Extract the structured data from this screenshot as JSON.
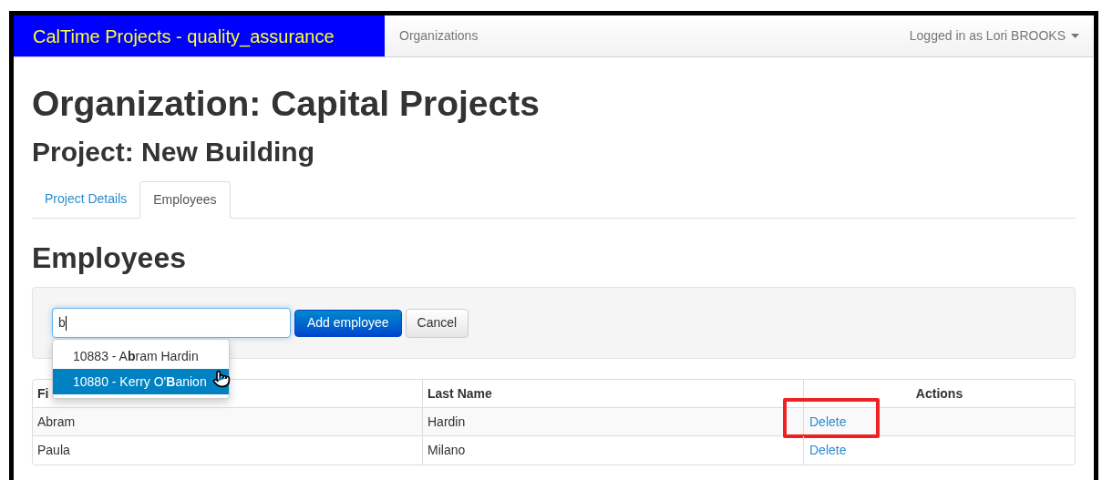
{
  "navbar": {
    "brand": "CalTime Projects - quality_assurance",
    "links": [
      {
        "label": "Organizations"
      }
    ],
    "user_menu": "Logged in as Lori BROOKS"
  },
  "headings": {
    "organization": "Organization: Capital Projects",
    "project": "Project: New Building"
  },
  "tabs": [
    {
      "label": "Project Details",
      "selected": false
    },
    {
      "label": "Employees",
      "selected": true
    }
  ],
  "section_title": "Employees",
  "add_form": {
    "value": "b",
    "buttons": [
      {
        "label": "Add employee",
        "kind": "primary"
      },
      {
        "label": "Cancel",
        "kind": "default"
      }
    ],
    "suggestions": [
      {
        "label": "10883 - A**b**ram Hardin",
        "selected": false
      },
      {
        "label": "10880 - Kerry O'**B**anion",
        "selected": true
      }
    ]
  },
  "table": {
    "columns": [
      "Fi",
      "Last Name",
      "Actions"
    ],
    "rows": [
      {
        "first_name": "Abram",
        "last_name": "Hardin",
        "action": "Delete",
        "highlighted": true
      },
      {
        "first_name": "Paula",
        "last_name": "Milano",
        "action": "Delete",
        "highlighted": false
      }
    ]
  }
}
